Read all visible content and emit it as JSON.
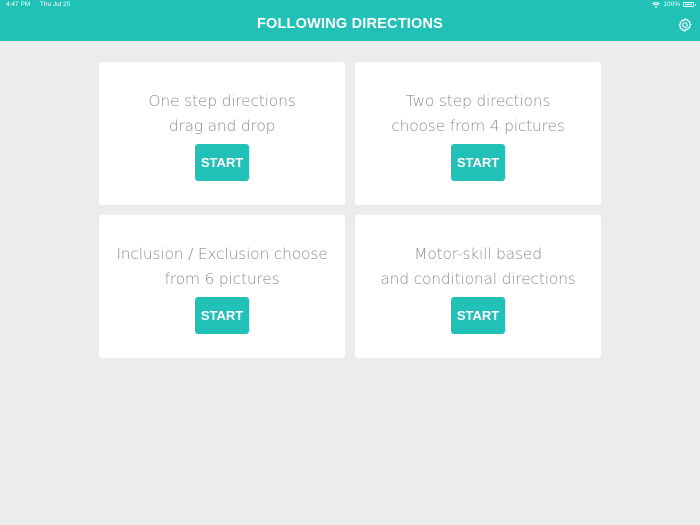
{
  "status_bar": {
    "time": "4:47 PM",
    "date": "Thu Jul 20",
    "battery": "100%"
  },
  "header": {
    "title": "FOLLOWING DIRECTIONS",
    "settings_icon": "gear-icon",
    "color": "#22c1b7"
  },
  "cards": [
    {
      "line1": "One step directions",
      "line2": "drag and drop",
      "button": "START"
    },
    {
      "line1": "Two step directions",
      "line2": "choose from 4 pictures",
      "button": "START"
    },
    {
      "line1": "Inclusion / Exclusion choose",
      "line2": "from 6 pictures",
      "button": "START"
    },
    {
      "line1": "Motor-skill based",
      "line2": "and conditional directions",
      "button": "START"
    }
  ]
}
